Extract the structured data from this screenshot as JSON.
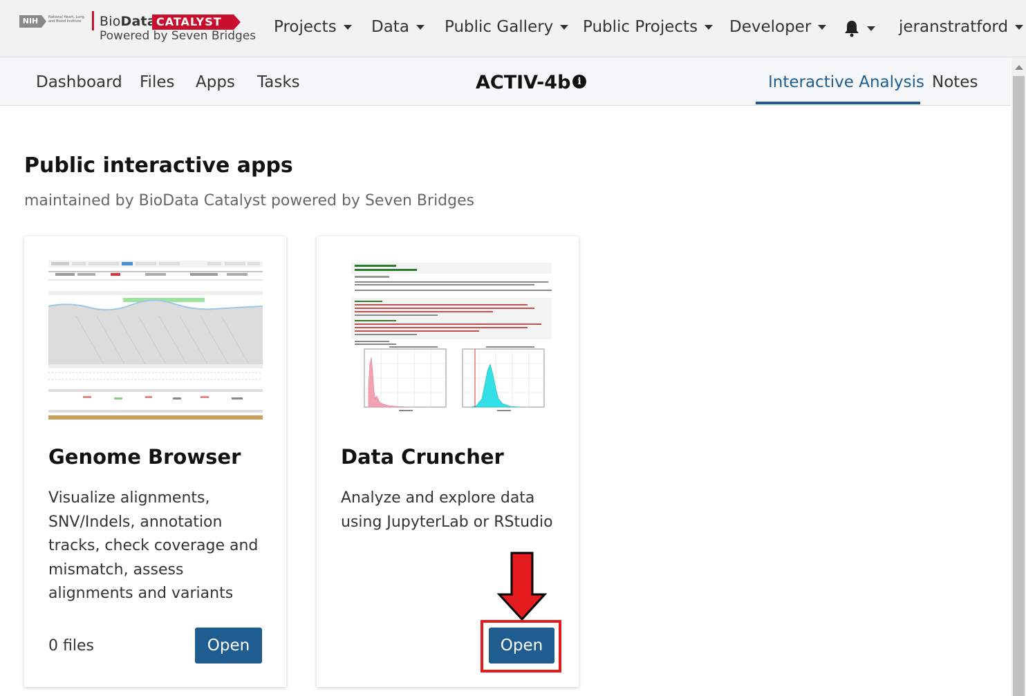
{
  "navbar": {
    "logo": {
      "nih": "NIH",
      "institute": "National Heart, Lung, and Blood Institute",
      "biodata_prefix": "Bio",
      "biodata_bold": "Data",
      "catalyst": "CATALYST",
      "powered": "Powered by Seven Bridges"
    },
    "items": [
      {
        "label": "Projects"
      },
      {
        "label": "Data"
      },
      {
        "label": "Public Gallery"
      },
      {
        "label": "Public Projects"
      },
      {
        "label": "Developer"
      }
    ],
    "user": "jeranstratford",
    "notifications_icon": "bell-icon"
  },
  "project_nav": {
    "links": [
      "Dashboard",
      "Files",
      "Apps",
      "Tasks"
    ],
    "title": "ACTIV-4b",
    "info_icon": "i",
    "tabs": [
      {
        "label": "Interactive Analysis",
        "active": true
      },
      {
        "label": "Notes",
        "active": false
      }
    ]
  },
  "main": {
    "title": "Public interactive apps",
    "subtitle": "maintained by BioData Catalyst powered by Seven Bridges",
    "apps": [
      {
        "name": "Genome Browser",
        "description": "Visualize alignments, SNV/Indels, annotation tracks, check coverage and mismatch, assess alignments and variants",
        "files": "0 files",
        "button": "Open",
        "thumbnail_icon": "genome-browser-screenshot"
      },
      {
        "name": "Data Cruncher",
        "description": "Analyze and explore data using JupyterLab or RStudio",
        "button": "Open",
        "thumbnail_icon": "jupyter-notebook-screenshot"
      }
    ]
  },
  "annotation": {
    "color": "#e41a1c",
    "target": "Data Cruncher Open button"
  },
  "colors": {
    "accent": "#1f5d91",
    "brand_red": "#c8102e",
    "nav_bg": "#f2f2f2"
  }
}
